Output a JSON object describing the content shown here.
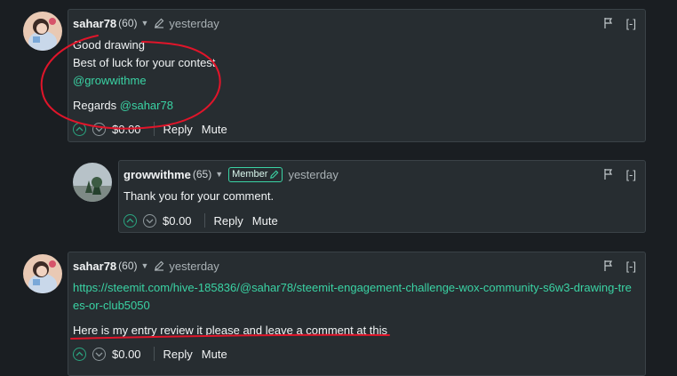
{
  "comments": [
    {
      "user": "sahar78",
      "rep": "(60)",
      "time": "yesterday",
      "collapse": "[-]",
      "lines": [
        "Good drawing",
        "Best of luck for your contest"
      ],
      "link": "@growwithme",
      "regards_label": "Regards",
      "regards_link": "@sahar78",
      "payout": "$0.00",
      "reply": "Reply",
      "mute": "Mute"
    },
    {
      "user": "growwithme",
      "rep": "(65)",
      "badge": "Member",
      "time": "yesterday",
      "collapse": "[-]",
      "text": "Thank you for your comment.",
      "payout": "$0.00",
      "reply": "Reply",
      "mute": "Mute"
    },
    {
      "user": "sahar78",
      "rep": "(60)",
      "time": "yesterday",
      "collapse": "[-]",
      "link": "https://steemit.com/hive-185836/@sahar78/steemit-engagement-challenge-wox-community-s6w3-drawing-trees-or-club5050",
      "text": "Here is my entry review it please and leave a comment at this",
      "payout": "$0.00",
      "reply": "Reply",
      "mute": "Mute"
    }
  ],
  "colors": {
    "background": "#1a1e22",
    "card": "#272d31",
    "accent": "#3ad3a4",
    "annotation": "#e0152a"
  },
  "icons": [
    "chevron-down-icon",
    "pencil-icon",
    "flag-icon",
    "upvote-icon",
    "downvote-icon",
    "member-pencil-icon"
  ]
}
